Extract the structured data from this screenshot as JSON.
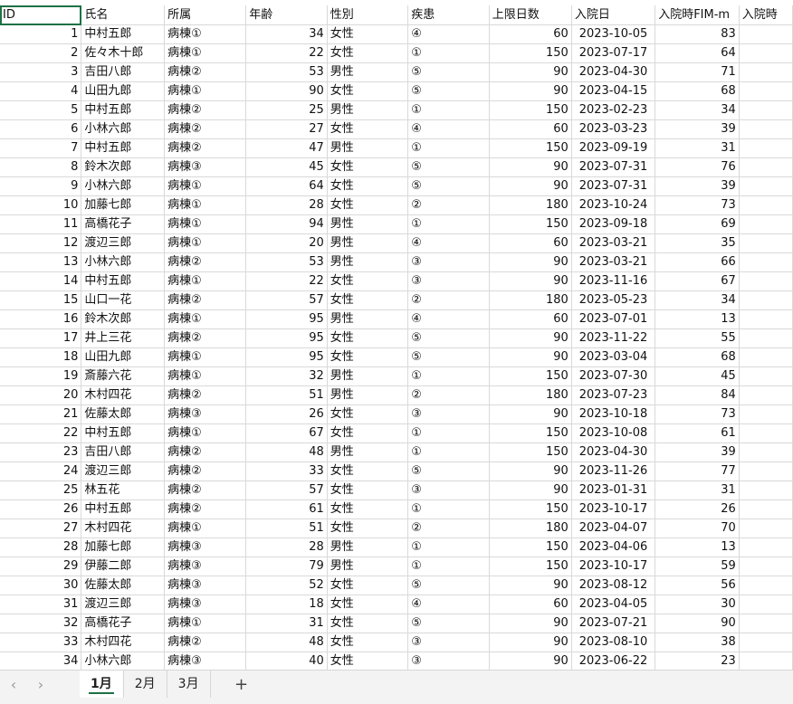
{
  "headers": [
    "ID",
    "氏名",
    "所属",
    "年齢",
    "性別",
    "疾患",
    "上限日数",
    "入院日",
    "入院時FIM-m",
    "入院時"
  ],
  "rows": [
    [
      "1",
      "中村五郎",
      "病棟①",
      "34",
      "女性",
      "④",
      "60",
      "2023-10-05",
      "83"
    ],
    [
      "2",
      "佐々木十郎",
      "病棟①",
      "22",
      "女性",
      "①",
      "150",
      "2023-07-17",
      "64"
    ],
    [
      "3",
      "吉田八郎",
      "病棟②",
      "53",
      "男性",
      "⑤",
      "90",
      "2023-04-30",
      "71"
    ],
    [
      "4",
      "山田九郎",
      "病棟①",
      "90",
      "女性",
      "⑤",
      "90",
      "2023-04-15",
      "68"
    ],
    [
      "5",
      "中村五郎",
      "病棟②",
      "25",
      "男性",
      "①",
      "150",
      "2023-02-23",
      "34"
    ],
    [
      "6",
      "小林六郎",
      "病棟②",
      "27",
      "女性",
      "④",
      "60",
      "2023-03-23",
      "39"
    ],
    [
      "7",
      "中村五郎",
      "病棟②",
      "47",
      "男性",
      "①",
      "150",
      "2023-09-19",
      "31"
    ],
    [
      "8",
      "鈴木次郎",
      "病棟③",
      "45",
      "女性",
      "⑤",
      "90",
      "2023-07-31",
      "76"
    ],
    [
      "9",
      "小林六郎",
      "病棟①",
      "64",
      "女性",
      "⑤",
      "90",
      "2023-07-31",
      "39"
    ],
    [
      "10",
      "加藤七郎",
      "病棟①",
      "28",
      "女性",
      "②",
      "180",
      "2023-10-24",
      "73"
    ],
    [
      "11",
      "高橋花子",
      "病棟①",
      "94",
      "男性",
      "①",
      "150",
      "2023-09-18",
      "69"
    ],
    [
      "12",
      "渡辺三郎",
      "病棟①",
      "20",
      "男性",
      "④",
      "60",
      "2023-03-21",
      "35"
    ],
    [
      "13",
      "小林六郎",
      "病棟②",
      "53",
      "男性",
      "③",
      "90",
      "2023-03-21",
      "66"
    ],
    [
      "14",
      "中村五郎",
      "病棟①",
      "22",
      "女性",
      "③",
      "90",
      "2023-11-16",
      "67"
    ],
    [
      "15",
      "山口一花",
      "病棟②",
      "57",
      "女性",
      "②",
      "180",
      "2023-05-23",
      "34"
    ],
    [
      "16",
      "鈴木次郎",
      "病棟①",
      "95",
      "男性",
      "④",
      "60",
      "2023-07-01",
      "13"
    ],
    [
      "17",
      "井上三花",
      "病棟②",
      "95",
      "女性",
      "⑤",
      "90",
      "2023-11-22",
      "55"
    ],
    [
      "18",
      "山田九郎",
      "病棟①",
      "95",
      "女性",
      "⑤",
      "90",
      "2023-03-04",
      "68"
    ],
    [
      "19",
      "斎藤六花",
      "病棟①",
      "32",
      "男性",
      "①",
      "150",
      "2023-07-30",
      "45"
    ],
    [
      "20",
      "木村四花",
      "病棟②",
      "51",
      "男性",
      "②",
      "180",
      "2023-07-23",
      "84"
    ],
    [
      "21",
      "佐藤太郎",
      "病棟③",
      "26",
      "女性",
      "③",
      "90",
      "2023-10-18",
      "73"
    ],
    [
      "22",
      "中村五郎",
      "病棟①",
      "67",
      "女性",
      "①",
      "150",
      "2023-10-08",
      "61"
    ],
    [
      "23",
      "吉田八郎",
      "病棟②",
      "48",
      "男性",
      "①",
      "150",
      "2023-04-30",
      "39"
    ],
    [
      "24",
      "渡辺三郎",
      "病棟②",
      "33",
      "女性",
      "⑤",
      "90",
      "2023-11-26",
      "77"
    ],
    [
      "25",
      "林五花",
      "病棟②",
      "57",
      "女性",
      "③",
      "90",
      "2023-01-31",
      "31"
    ],
    [
      "26",
      "中村五郎",
      "病棟②",
      "61",
      "女性",
      "①",
      "150",
      "2023-10-17",
      "26"
    ],
    [
      "27",
      "木村四花",
      "病棟①",
      "51",
      "女性",
      "②",
      "180",
      "2023-04-07",
      "70"
    ],
    [
      "28",
      "加藤七郎",
      "病棟③",
      "28",
      "男性",
      "①",
      "150",
      "2023-04-06",
      "13"
    ],
    [
      "29",
      "伊藤二郎",
      "病棟③",
      "79",
      "男性",
      "①",
      "150",
      "2023-10-17",
      "59"
    ],
    [
      "30",
      "佐藤太郎",
      "病棟③",
      "52",
      "女性",
      "⑤",
      "90",
      "2023-08-12",
      "56"
    ],
    [
      "31",
      "渡辺三郎",
      "病棟③",
      "18",
      "女性",
      "④",
      "60",
      "2023-04-05",
      "30"
    ],
    [
      "32",
      "高橋花子",
      "病棟①",
      "31",
      "女性",
      "⑤",
      "90",
      "2023-07-21",
      "90"
    ],
    [
      "33",
      "木村四花",
      "病棟②",
      "48",
      "女性",
      "③",
      "90",
      "2023-08-10",
      "38"
    ],
    [
      "34",
      "小林六郎",
      "病棟③",
      "40",
      "女性",
      "③",
      "90",
      "2023-06-22",
      "23"
    ]
  ],
  "sheet_tabs": [
    "1月",
    "2月",
    "3月"
  ],
  "active_tab": "1月",
  "nav_prev": "‹",
  "nav_next": "›",
  "add_sheet": "+"
}
